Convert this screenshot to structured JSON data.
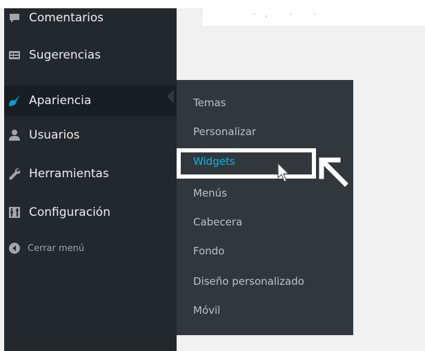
{
  "content": {
    "ghost_text": "·, · ·"
  },
  "sidebar": {
    "items": [
      {
        "label": "Comentarios",
        "icon": "comment-icon"
      },
      {
        "label": "Sugerencias",
        "icon": "suggestions-icon"
      },
      {
        "label": "Apariencia",
        "icon": "appearance-brush-icon",
        "active": true
      },
      {
        "label": "Usuarios",
        "icon": "users-icon"
      },
      {
        "label": "Herramientas",
        "icon": "wrench-icon"
      },
      {
        "label": "Configuración",
        "icon": "settings-icon"
      }
    ],
    "collapse": {
      "label": "Cerrar menú",
      "icon": "collapse-arrow-icon"
    }
  },
  "submenu": {
    "items": [
      {
        "label": "Temas"
      },
      {
        "label": "Personalizar"
      },
      {
        "label": "Widgets",
        "current": true
      },
      {
        "label": "Menús"
      },
      {
        "label": "Cabecera"
      },
      {
        "label": "Fondo"
      },
      {
        "label": "Diseño personalizado"
      },
      {
        "label": "Móvil"
      }
    ]
  },
  "colors": {
    "sidebar_bg": "#23282d",
    "submenu_bg": "#32373c",
    "active_accent": "#00a0d2",
    "current_link": "#00b9eb",
    "page_bg": "#f1f1f1",
    "annotation": "#ffffff"
  }
}
